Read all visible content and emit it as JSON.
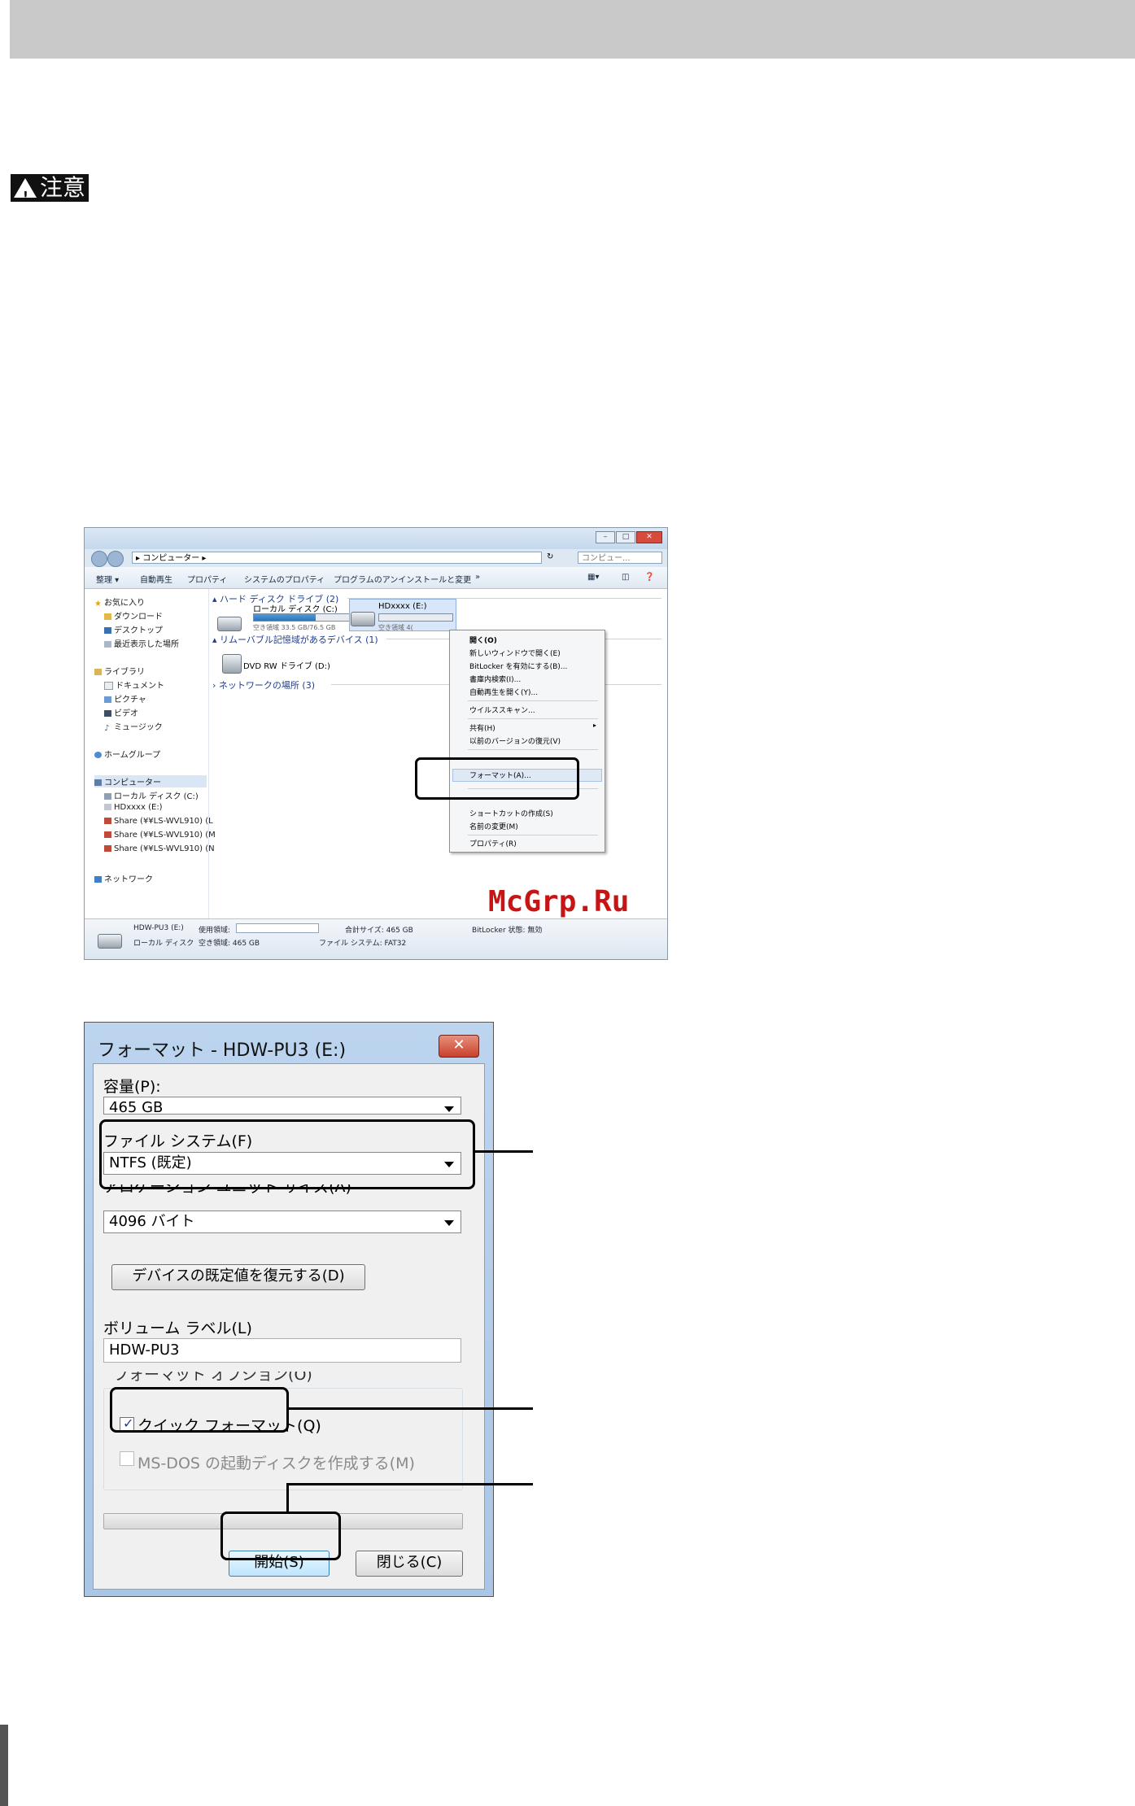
{
  "page": {
    "caution_label": "注意"
  },
  "explorer": {
    "address": "▸ コンピューター ▸",
    "search_placeholder": "コンピュー...",
    "toolbar": [
      "整理 ▾",
      "自動再生",
      "プロパティ",
      "システムのプロパティ",
      "プログラムのアンインストールと変更",
      "»"
    ],
    "sidebar": {
      "favorites": "お気に入り",
      "download": "ダウンロード",
      "desktop": "デスクトップ",
      "recent": "最近表示した場所",
      "libraries": "ライブラリ",
      "documents": "ドキュメント",
      "pictures": "ピクチャ",
      "videos": "ビデオ",
      "music": "ミュージック",
      "homegroup": "ホームグループ",
      "computer": "コンピューター",
      "local_disk": "ローカル ディスク (C:)",
      "hd_drive": "HDxxxx",
      "hd_letter": "(E:)",
      "share1": "Share (¥¥LS-WVL910) (L",
      "share2": "Share (¥¥LS-WVL910) (M",
      "share3": "Share (¥¥LS-WVL910) (N",
      "network": "ネットワーク"
    },
    "main": {
      "hdd_group": "ハード ディスク ドライブ (2)",
      "local_disk": "ローカル ディスク (C:)",
      "local_free": "空き領域 33.5 GB/76.5 GB",
      "local_used_fraction": 0.56,
      "hd_drive": "HDxxxx (E:)",
      "hd_free": "空き領域 4(",
      "removable_group": "リムーバブル記憶域があるデバイス (1)",
      "dvd": "DVD RW ドライブ (D:)",
      "network_group": "ネットワークの場所 (3)"
    },
    "context_menu": {
      "open": "開く(O)",
      "open_new": "新しいウィンドウで開く(E)",
      "bitlocker": "BitLocker を有効にする(B)...",
      "search": "書庫内検索(I)...",
      "autoplay": "自動再生を開く(Y)...",
      "virus": "ウイルススキャン...",
      "share": "共有(H)",
      "restore": "以前のバージョンの復元(V)",
      "format": "フォーマット(A)...",
      "shortcut": "ショートカットの作成(S)",
      "rename": "名前の変更(M)",
      "properties": "プロパティ(R)"
    },
    "status": {
      "drive_name": "HDW-PU3 (E:)",
      "used_label": "使用領域:",
      "total_label": "合計サイズ: 465 GB",
      "bitlocker_label": "BitLocker 状態: 無効",
      "type_label": "ローカル ディスク",
      "free_label": "空き領域: 465 GB",
      "fs_label": "ファイル システム: FAT32"
    },
    "watermark": "McGrp.Ru"
  },
  "format_dialog": {
    "title": "フォーマット - HDW-PU3 (E:)",
    "close": "✕",
    "capacity_label": "容量(P):",
    "capacity_value": "465 GB",
    "filesystem_label": "ファイル システム(F)",
    "filesystem_value": "NTFS (既定)",
    "allocation_label": "アロケーション ユニット サイズ(A)",
    "allocation_value": "4096 バイト",
    "restore_button": "デバイスの既定値を復元する(D)",
    "volume_label": "ボリューム ラベル(L)",
    "volume_value": "HDW-PU3",
    "options_label": "フォーマット オプション(O)",
    "quick_format": "クイック フォーマット(Q)",
    "msdos_disk": "MS-DOS の起動ディスクを作成する(M)",
    "start_button": "開始(S)",
    "close_button": "閉じる(C)"
  }
}
